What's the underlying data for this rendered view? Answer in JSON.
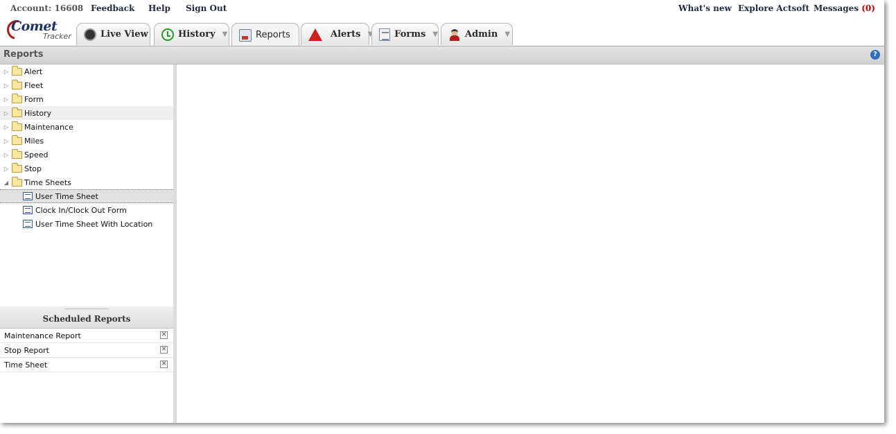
{
  "top_links": {
    "account": "Account: 16608",
    "feedback": "Feedback",
    "help": "Help",
    "sign_out": "Sign Out",
    "whats_new": "What's new",
    "explore": "Explore Actsoft",
    "messages_label": "Messages",
    "messages_count": "(0)"
  },
  "logo": {
    "name": "Comet",
    "sub": "Tracker"
  },
  "tabs": [
    {
      "label": "Live View",
      "icon": "live-view-icon"
    },
    {
      "label": "History",
      "icon": "clock-icon",
      "dropdown": "▼"
    },
    {
      "label": "Reports",
      "icon": "reports-icon",
      "active": true
    },
    {
      "label": "Alerts",
      "icon": "warning-icon",
      "dropdown": "▼"
    },
    {
      "label": "Forms",
      "icon": "form-icon",
      "dropdown": "▼"
    },
    {
      "label": "Admin",
      "icon": "admin-icon",
      "dropdown": "▼"
    }
  ],
  "header": {
    "title": "Reports",
    "help_icon": "?"
  },
  "tree": {
    "folders": [
      "Alert",
      "Fleet",
      "Form",
      "History",
      "Maintenance",
      "Miles",
      "Speed",
      "Stop",
      "Time Sheets"
    ],
    "expand_glyph": "▷",
    "collapse_glyph": "◢",
    "time_sheet_reports": [
      "User Time Sheet",
      "Clock In/Clock Out Form",
      "User Time Sheet With Location"
    ]
  },
  "scheduled": {
    "title": "Scheduled Reports",
    "close_glyph": "✕",
    "items": [
      "Maintenance Report",
      "Stop Report",
      "Time Sheet"
    ]
  },
  "colors": {
    "accent": "#1f2a44",
    "alert_red": "#cc2020",
    "message_count": "#bb0000"
  }
}
